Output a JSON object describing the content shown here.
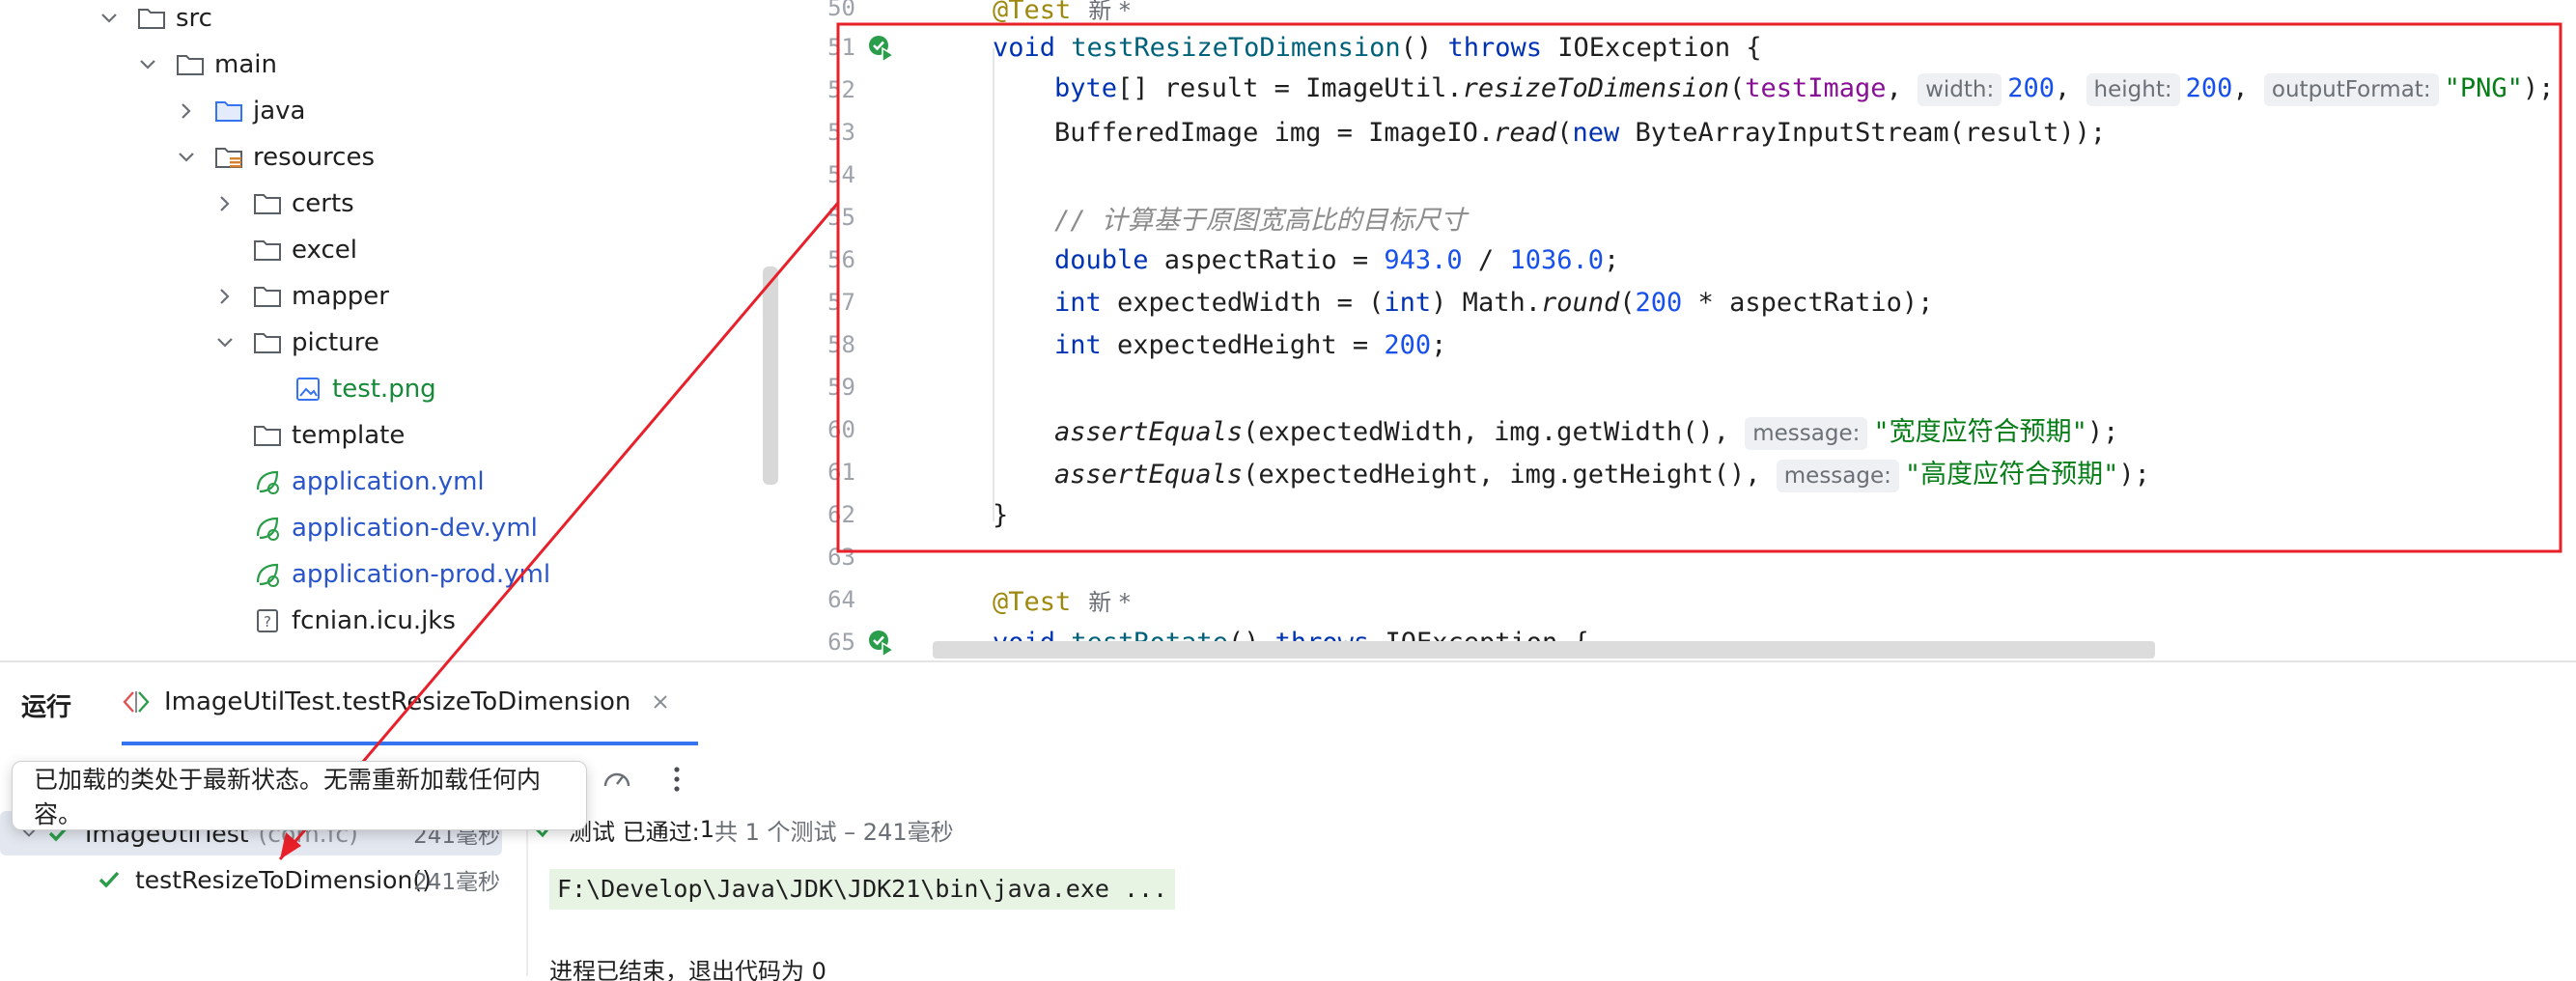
{
  "tree": {
    "items": [
      {
        "label": "src",
        "icon": "folder-icon",
        "expanded": true
      },
      {
        "label": "main",
        "icon": "folder-icon",
        "expanded": true
      },
      {
        "label": "java",
        "icon": "source-folder-icon",
        "expanded": false
      },
      {
        "label": "resources",
        "icon": "resources-folder-icon",
        "expanded": true
      },
      {
        "label": "certs",
        "icon": "folder-icon",
        "expanded": false
      },
      {
        "label": "excel",
        "icon": "folder-icon"
      },
      {
        "label": "mapper",
        "icon": "folder-icon",
        "expanded": false
      },
      {
        "label": "picture",
        "icon": "folder-icon",
        "expanded": true
      },
      {
        "label": "test.png",
        "icon": "image-file-icon"
      },
      {
        "label": "template",
        "icon": "folder-icon"
      },
      {
        "label": "application.yml",
        "icon": "spring-config-icon"
      },
      {
        "label": "application-dev.yml",
        "icon": "spring-config-icon"
      },
      {
        "label": "application-prod.yml",
        "icon": "spring-config-icon"
      },
      {
        "label": "fcnian.icu.jks",
        "icon": "unknown-file-icon"
      }
    ]
  },
  "editor": {
    "lines": [
      {
        "n": "50",
        "kind": "test-annotation",
        "text": "@Test",
        "badge": "新 *"
      },
      {
        "n": "51",
        "kind": "method-signature",
        "kw": "void",
        "name": "testResizeToDimension",
        "rest": "() ",
        "throws": "throws",
        "exc": "IOException {"
      },
      {
        "n": "52"
      },
      {
        "n": "53"
      },
      {
        "n": "54"
      },
      {
        "n": "55"
      },
      {
        "n": "56"
      },
      {
        "n": "57"
      },
      {
        "n": "58"
      },
      {
        "n": "59"
      },
      {
        "n": "60"
      },
      {
        "n": "61"
      },
      {
        "n": "62"
      },
      {
        "n": "63"
      },
      {
        "n": "64",
        "text": "@Test",
        "badge": "新 *"
      },
      {
        "n": "65",
        "kw": "void",
        "name": "testRotate",
        "rest": "() ",
        "throws": "throws",
        "exc": "IOException {"
      }
    ],
    "l52": {
      "t1": "byte",
      "t2": "[] result = ImageUtil.",
      "fn": "resizeToDimension",
      "t3": "(",
      "fld": "testImage",
      "t4": ", ",
      "h1": "width:",
      "v1": "200",
      "t5": ", ",
      "h2": "height:",
      "v2": "200",
      "t6": ", ",
      "h3": "outputFormat:",
      "s1": "\"PNG\"",
      "t7": ");"
    },
    "l53": {
      "t1": "BufferedImage img = ImageIO.",
      "fn": "read",
      "t2": "(",
      "kw": "new",
      "t3": " ByteArrayInputStream(result));"
    },
    "l55": {
      "comment": "// 计算基于原图宽高比的目标尺寸"
    },
    "l56": {
      "kw": "double",
      "t1": " aspectRatio = ",
      "n1": "943.0",
      "t2": " / ",
      "n2": "1036.0",
      "t3": ";"
    },
    "l57": {
      "kw": "int",
      "t1": " expectedWidth = (",
      "kw2": "int",
      "t2": ") Math.",
      "fn": "round",
      "t3": "(",
      "n1": "200",
      "t4": " * aspectRatio);"
    },
    "l58": {
      "kw": "int",
      "t1": " expectedHeight = ",
      "n1": "200",
      "t2": ";"
    },
    "l60": {
      "fn": "assertEquals",
      "t1": "(expectedWidth, img.getWidth(), ",
      "hint": "message:",
      "s1": "\"宽度应符合预期\"",
      "t2": ");"
    },
    "l61": {
      "fn": "assertEquals",
      "t1": "(expectedHeight, img.getHeight(), ",
      "hint": "message:",
      "s1": "\"高度应符合预期\"",
      "t2": ");"
    },
    "l62": {
      "t1": "}"
    }
  },
  "run": {
    "title": "运行",
    "tab_label": "ImageUtilTest.testResizeToDimension",
    "tooltip": "已加载的类处于最新状态。无需重新加载任何内容。",
    "tree": [
      {
        "label": "ImageUtilTest",
        "pkg": "(com.fc)",
        "duration": "241毫秒"
      },
      {
        "label": "testResizeToDimension()",
        "duration": "241毫秒"
      }
    ],
    "status": {
      "prefix": "测试 已通过: ",
      "count": "1",
      "suffix": "共 1 个测试 – 241毫秒"
    },
    "command": "F:\\Develop\\Java\\JDK\\JDK21\\bin\\java.exe ...",
    "next_line": "进程已结束，退出代码为 0"
  },
  "colors": {
    "highlight_box": "#e8202a",
    "accent": "#3574f0",
    "pass": "#2a9d4a"
  }
}
